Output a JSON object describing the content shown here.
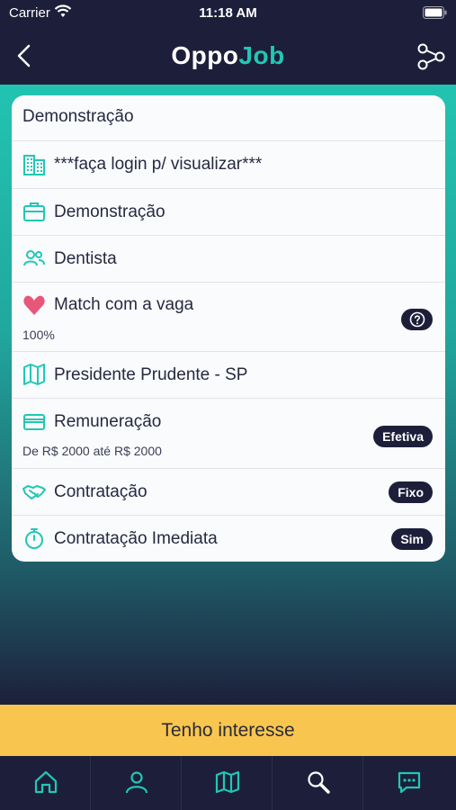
{
  "status_bar": {
    "carrier": "Carrier",
    "time": "11:18 AM"
  },
  "header": {
    "logo_primary": "Oppo",
    "logo_accent": "Job"
  },
  "colors": {
    "dark_navy": "#1d1f3a",
    "teal_accent": "#21c7b5",
    "cta_yellow": "#f8c64e",
    "heart_pink": "#e8567a"
  },
  "job": {
    "title": "Demonstração",
    "company": "***faça login p/ visualizar***",
    "position": "Demonstração",
    "category": "Dentista",
    "match_label": "Match com a vaga",
    "match_value": "100%",
    "location": "Presidente Prudente - SP",
    "salary_label": "Remuneração",
    "salary_range": "De R$ 2000 até R$ 2000",
    "salary_badge": "Efetiva",
    "hiring_label": "Contratação",
    "hiring_badge": "Fixo",
    "immediate_label": "Contratação Imediata",
    "immediate_badge": "Sim",
    "icons": [
      "building-icon",
      "briefcase-icon",
      "users-icon",
      "heart-icon",
      "map-icon",
      "card-icon",
      "handshake-icon",
      "stopwatch-icon",
      "help-icon"
    ]
  },
  "cta": {
    "label": "Tenho interesse"
  },
  "tabbar": {
    "items": [
      "home-icon",
      "profile-icon",
      "map-icon",
      "search-icon",
      "chat-icon"
    ]
  }
}
